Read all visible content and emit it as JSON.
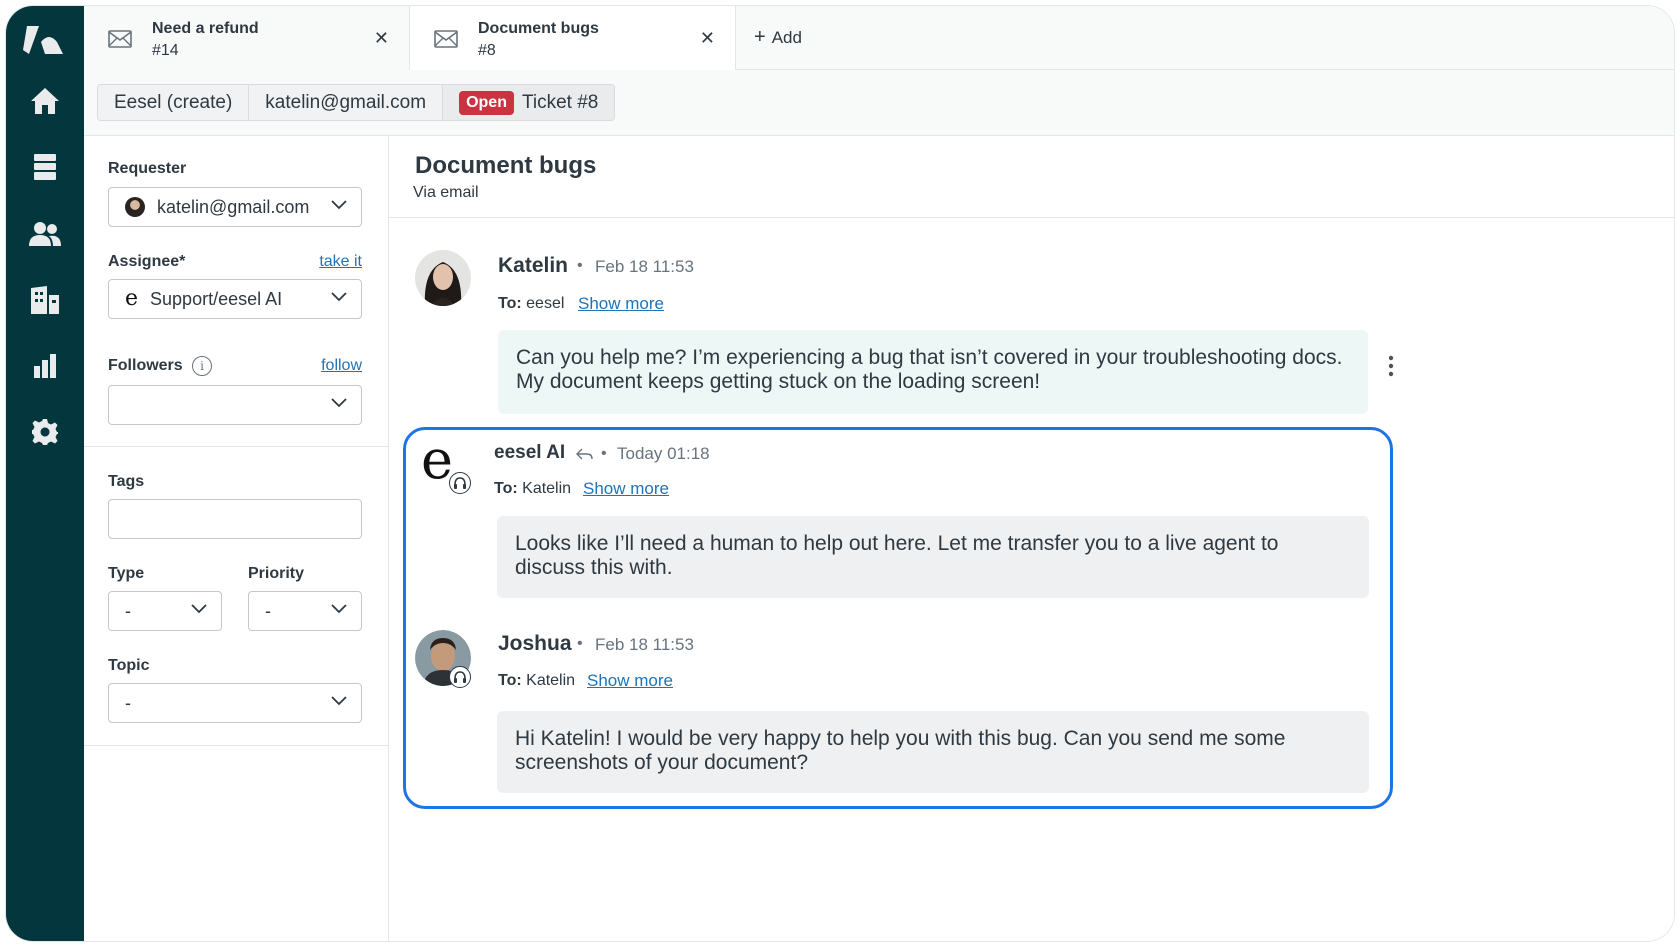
{
  "tabs": [
    {
      "title": "Need a refund",
      "number": "#14"
    },
    {
      "title": "Document bugs",
      "number": "#8"
    }
  ],
  "add_tab_label": "Add",
  "breadcrumb": {
    "org": "Eesel (create)",
    "requester": "katelin@gmail.com",
    "status": "Open",
    "ticket": "Ticket #8"
  },
  "properties": {
    "requester_label": "Requester",
    "requester_value": "katelin@gmail.com",
    "assignee_label": "Assignee*",
    "take_it": "take it",
    "assignee_value": "Support/eesel AI",
    "followers_label": "Followers",
    "follow": "follow",
    "followers_value": "",
    "tags_label": "Tags",
    "tags_value": "",
    "type_label": "Type",
    "type_value": "-",
    "priority_label": "Priority",
    "priority_value": "-",
    "topic_label": "Topic",
    "topic_value": "-"
  },
  "ticket": {
    "subject": "Document bugs",
    "via": "Via email"
  },
  "messages": [
    {
      "author": "Katelin",
      "time": "Feb 18 11:53",
      "to_label": "To:",
      "to": "eesel",
      "show_more": "Show more",
      "body": "Can you help me? I’m experiencing a bug that isn’t covered in your troubleshooting docs. My document keeps getting stuck on the loading screen!"
    },
    {
      "author": "eesel AI",
      "time": "Today 01:18",
      "to_label": "To:",
      "to": "Katelin",
      "show_more": "Show more",
      "body": "Looks like I’ll need a human to help out here. Let me transfer you to a live agent to discuss this with."
    },
    {
      "author": "Joshua",
      "time": "Feb 18 11:53",
      "to_label": "To:",
      "to": "Katelin",
      "show_more": "Show more",
      "body": "Hi Katelin! I would be very happy to help you with this bug. Can you send me some screenshots of your document?"
    }
  ],
  "colors": {
    "rail": "#03363d",
    "accent": "#1f73b7",
    "open_badge": "#cc3340",
    "highlight": "#1f73e8"
  },
  "icons": [
    "logo-icon",
    "home-icon",
    "views-icon",
    "customers-icon",
    "organizations-icon",
    "reporting-icon",
    "settings-icon",
    "mail-icon",
    "close-icon",
    "plus-icon",
    "chevron-down-icon",
    "info-icon",
    "kebab-icon",
    "reply-icon",
    "headset-icon"
  ]
}
